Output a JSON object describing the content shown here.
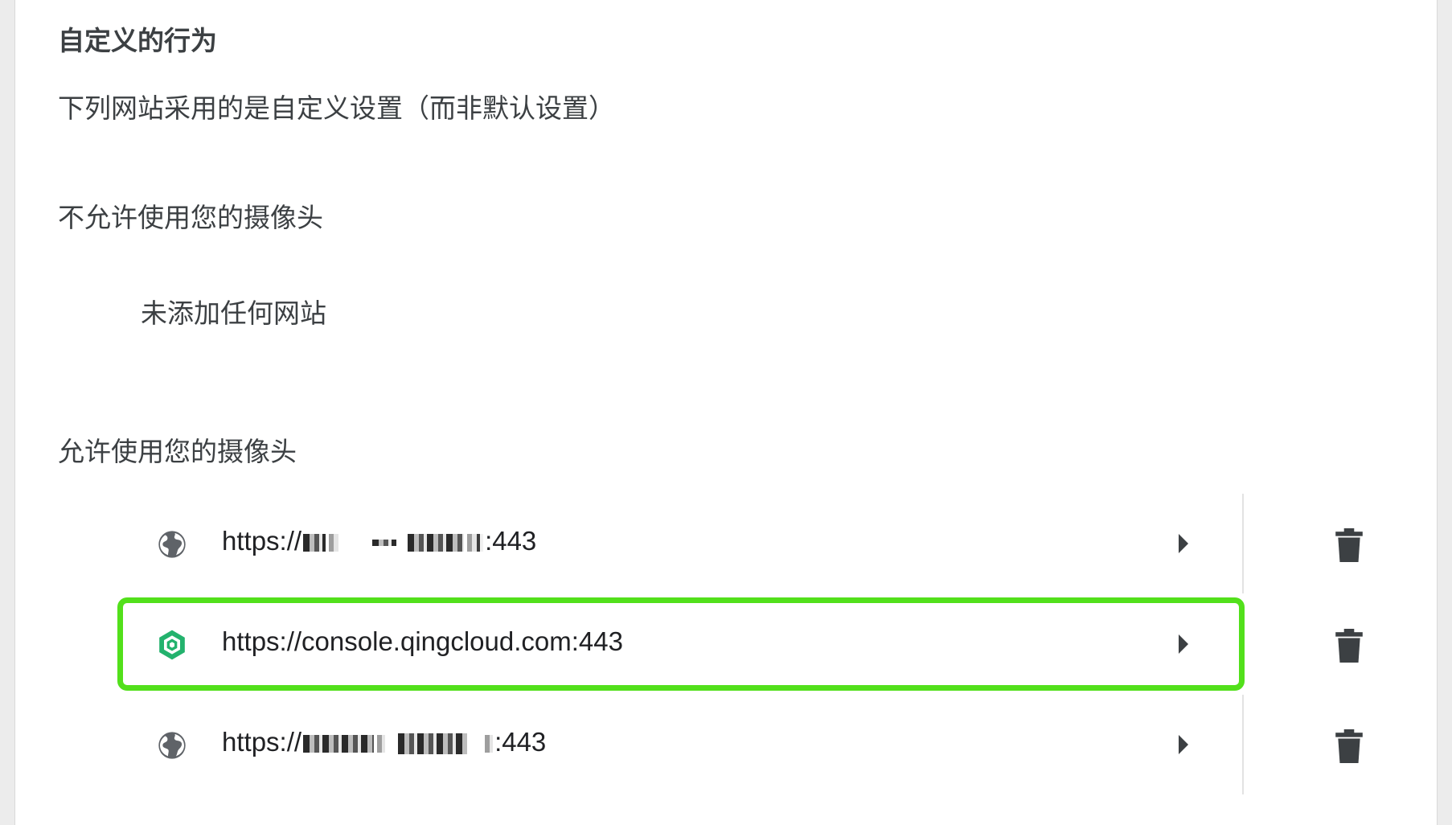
{
  "section": {
    "title": "自定义的行为",
    "description": "下列网站采用的是自定义设置（而非默认设置）"
  },
  "blocked": {
    "heading": "不允许使用您的摄像头",
    "empty_message": "未添加任何网站"
  },
  "allowed": {
    "heading": "允许使用您的摄像头",
    "sites": [
      {
        "url_prefix": "https://",
        "url_suffix": ":443",
        "redacted": true,
        "icon": "globe-icon"
      },
      {
        "url": "https://console.qingcloud.com:443",
        "redacted": false,
        "icon": "qingcloud-logo-icon",
        "highlighted": true
      },
      {
        "url_prefix": "https://",
        "url_suffix": ":443",
        "redacted": true,
        "icon": "globe-icon"
      }
    ]
  },
  "colors": {
    "highlight": "#52e01b",
    "qingcloud_green": "#23b26d",
    "icon_gray": "#5f6368"
  }
}
